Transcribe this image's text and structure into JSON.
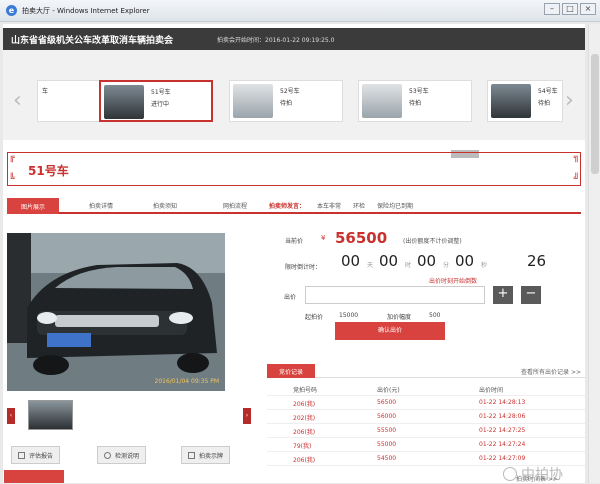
{
  "window": {
    "title": "拍卖大厅 - Windows Internet Explorer",
    "buttons": [
      "–",
      "□",
      "×"
    ]
  },
  "header": {
    "auction_name": "山东省省级机关公车改革取消车辆拍卖会",
    "start_time": "拍卖会开始时间：2016-01-22 09:19:25.0"
  },
  "carousel": {
    "items": [
      {
        "lot": "车",
        "status": ""
      },
      {
        "lot": "51号车",
        "status": "进行中"
      },
      {
        "lot": "52号车",
        "status": "待拍"
      },
      {
        "lot": "53号车",
        "status": "待拍"
      },
      {
        "lot": "54号车",
        "status": "待拍"
      }
    ]
  },
  "lot": {
    "title": "51号车"
  },
  "tabs": {
    "photos": "图片展示",
    "details": "拍卖详情",
    "rules": "拍卖须知",
    "guide": "网拍流程",
    "msg_label": "拍卖师发言：",
    "msg_text": "本车非常",
    "msg2": "环检",
    "msg3": "保险均已到期"
  },
  "photo": {
    "timestamp": "2016/01/04 09:35 PM"
  },
  "documents": {
    "evaluation": "评估报告",
    "inspection": "检测说明",
    "record": "拍卖示牌"
  },
  "bid": {
    "current_label": "当前价",
    "currency": "¥",
    "current_price": "56500",
    "price_note": "(出价额度不计价调整)",
    "countdown_label": "限时倒计时：",
    "countdown": [
      "00",
      "00",
      "00",
      "00",
      "26"
    ],
    "countdown_units": [
      "天",
      "时",
      "分",
      "秒"
    ],
    "countdown_note": "出价时刻开始倒数",
    "input_label": "出价",
    "input_value": "",
    "plus": "+",
    "minus": "−",
    "start_price_label": "起拍价",
    "start_price": "15000",
    "increment_label": "加价幅度",
    "increment": "500",
    "submit": "确认出价"
  },
  "records": {
    "tab": "竞价记录",
    "more": "查看所有出价记录 >>",
    "headers": [
      "竞拍号码",
      "出价(元)",
      "出价时间"
    ],
    "rows": [
      [
        "206(我)",
        "56500",
        "01-22 14:28:13"
      ],
      [
        "202(我)",
        "56000",
        "01-22 14:28:06"
      ],
      [
        "206(我)",
        "55500",
        "01-22 14:27:25"
      ],
      [
        "79(我)",
        "55000",
        "01-22 14:27:24"
      ],
      [
        "206(我)",
        "54500",
        "01-22 14:27:09"
      ]
    ]
  },
  "footer": {
    "link": "拍卖时间表 >>"
  },
  "watermark": "中拍协",
  "colors": {
    "accent": "#c9312e",
    "header": "#3b3b3b"
  }
}
